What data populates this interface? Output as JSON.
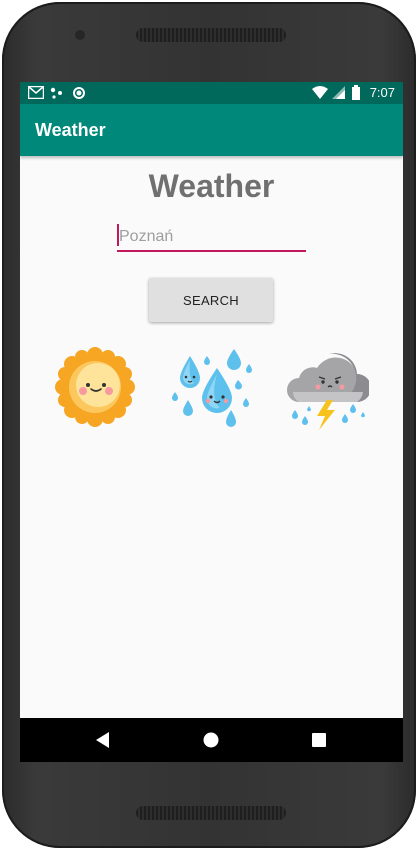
{
  "status_bar": {
    "time": "7:07",
    "icons": [
      "gmail-icon",
      "dots-icon",
      "circle-icon",
      "wifi-icon",
      "signal-icon",
      "battery-icon"
    ]
  },
  "app_bar": {
    "title": "Weather"
  },
  "main": {
    "heading": "Weather",
    "city_input": {
      "value": "",
      "placeholder": "Poznań"
    },
    "search_label": "SEARCH",
    "weather_icons": [
      "sun-icon",
      "rain-drops-icon",
      "storm-cloud-icon"
    ]
  },
  "nav_bar": {
    "buttons": [
      "back-icon",
      "home-icon",
      "recents-icon"
    ]
  },
  "colors": {
    "status_bar": "#00695c",
    "app_bar": "#00897b",
    "accent": "#c2185b",
    "heading": "#707070"
  }
}
